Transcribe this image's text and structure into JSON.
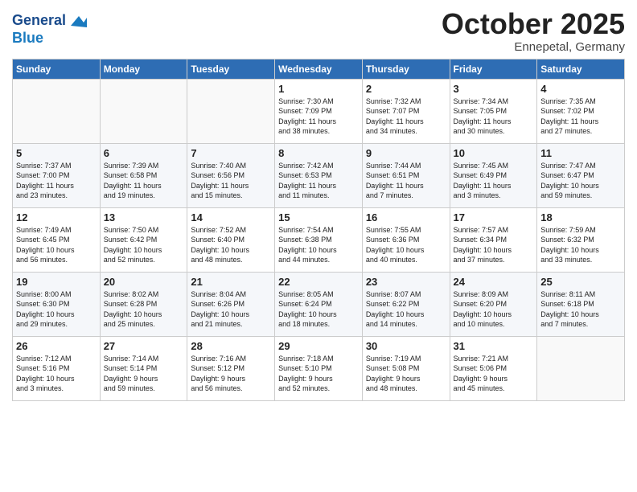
{
  "header": {
    "logo_line1": "General",
    "logo_line2": "Blue",
    "month": "October 2025",
    "location": "Ennepetal, Germany"
  },
  "weekdays": [
    "Sunday",
    "Monday",
    "Tuesday",
    "Wednesday",
    "Thursday",
    "Friday",
    "Saturday"
  ],
  "weeks": [
    [
      {
        "day": "",
        "text": ""
      },
      {
        "day": "",
        "text": ""
      },
      {
        "day": "",
        "text": ""
      },
      {
        "day": "1",
        "text": "Sunrise: 7:30 AM\nSunset: 7:09 PM\nDaylight: 11 hours\nand 38 minutes."
      },
      {
        "day": "2",
        "text": "Sunrise: 7:32 AM\nSunset: 7:07 PM\nDaylight: 11 hours\nand 34 minutes."
      },
      {
        "day": "3",
        "text": "Sunrise: 7:34 AM\nSunset: 7:05 PM\nDaylight: 11 hours\nand 30 minutes."
      },
      {
        "day": "4",
        "text": "Sunrise: 7:35 AM\nSunset: 7:02 PM\nDaylight: 11 hours\nand 27 minutes."
      }
    ],
    [
      {
        "day": "5",
        "text": "Sunrise: 7:37 AM\nSunset: 7:00 PM\nDaylight: 11 hours\nand 23 minutes."
      },
      {
        "day": "6",
        "text": "Sunrise: 7:39 AM\nSunset: 6:58 PM\nDaylight: 11 hours\nand 19 minutes."
      },
      {
        "day": "7",
        "text": "Sunrise: 7:40 AM\nSunset: 6:56 PM\nDaylight: 11 hours\nand 15 minutes."
      },
      {
        "day": "8",
        "text": "Sunrise: 7:42 AM\nSunset: 6:53 PM\nDaylight: 11 hours\nand 11 minutes."
      },
      {
        "day": "9",
        "text": "Sunrise: 7:44 AM\nSunset: 6:51 PM\nDaylight: 11 hours\nand 7 minutes."
      },
      {
        "day": "10",
        "text": "Sunrise: 7:45 AM\nSunset: 6:49 PM\nDaylight: 11 hours\nand 3 minutes."
      },
      {
        "day": "11",
        "text": "Sunrise: 7:47 AM\nSunset: 6:47 PM\nDaylight: 10 hours\nand 59 minutes."
      }
    ],
    [
      {
        "day": "12",
        "text": "Sunrise: 7:49 AM\nSunset: 6:45 PM\nDaylight: 10 hours\nand 56 minutes."
      },
      {
        "day": "13",
        "text": "Sunrise: 7:50 AM\nSunset: 6:42 PM\nDaylight: 10 hours\nand 52 minutes."
      },
      {
        "day": "14",
        "text": "Sunrise: 7:52 AM\nSunset: 6:40 PM\nDaylight: 10 hours\nand 48 minutes."
      },
      {
        "day": "15",
        "text": "Sunrise: 7:54 AM\nSunset: 6:38 PM\nDaylight: 10 hours\nand 44 minutes."
      },
      {
        "day": "16",
        "text": "Sunrise: 7:55 AM\nSunset: 6:36 PM\nDaylight: 10 hours\nand 40 minutes."
      },
      {
        "day": "17",
        "text": "Sunrise: 7:57 AM\nSunset: 6:34 PM\nDaylight: 10 hours\nand 37 minutes."
      },
      {
        "day": "18",
        "text": "Sunrise: 7:59 AM\nSunset: 6:32 PM\nDaylight: 10 hours\nand 33 minutes."
      }
    ],
    [
      {
        "day": "19",
        "text": "Sunrise: 8:00 AM\nSunset: 6:30 PM\nDaylight: 10 hours\nand 29 minutes."
      },
      {
        "day": "20",
        "text": "Sunrise: 8:02 AM\nSunset: 6:28 PM\nDaylight: 10 hours\nand 25 minutes."
      },
      {
        "day": "21",
        "text": "Sunrise: 8:04 AM\nSunset: 6:26 PM\nDaylight: 10 hours\nand 21 minutes."
      },
      {
        "day": "22",
        "text": "Sunrise: 8:05 AM\nSunset: 6:24 PM\nDaylight: 10 hours\nand 18 minutes."
      },
      {
        "day": "23",
        "text": "Sunrise: 8:07 AM\nSunset: 6:22 PM\nDaylight: 10 hours\nand 14 minutes."
      },
      {
        "day": "24",
        "text": "Sunrise: 8:09 AM\nSunset: 6:20 PM\nDaylight: 10 hours\nand 10 minutes."
      },
      {
        "day": "25",
        "text": "Sunrise: 8:11 AM\nSunset: 6:18 PM\nDaylight: 10 hours\nand 7 minutes."
      }
    ],
    [
      {
        "day": "26",
        "text": "Sunrise: 7:12 AM\nSunset: 5:16 PM\nDaylight: 10 hours\nand 3 minutes."
      },
      {
        "day": "27",
        "text": "Sunrise: 7:14 AM\nSunset: 5:14 PM\nDaylight: 9 hours\nand 59 minutes."
      },
      {
        "day": "28",
        "text": "Sunrise: 7:16 AM\nSunset: 5:12 PM\nDaylight: 9 hours\nand 56 minutes."
      },
      {
        "day": "29",
        "text": "Sunrise: 7:18 AM\nSunset: 5:10 PM\nDaylight: 9 hours\nand 52 minutes."
      },
      {
        "day": "30",
        "text": "Sunrise: 7:19 AM\nSunset: 5:08 PM\nDaylight: 9 hours\nand 48 minutes."
      },
      {
        "day": "31",
        "text": "Sunrise: 7:21 AM\nSunset: 5:06 PM\nDaylight: 9 hours\nand 45 minutes."
      },
      {
        "day": "",
        "text": ""
      }
    ]
  ]
}
